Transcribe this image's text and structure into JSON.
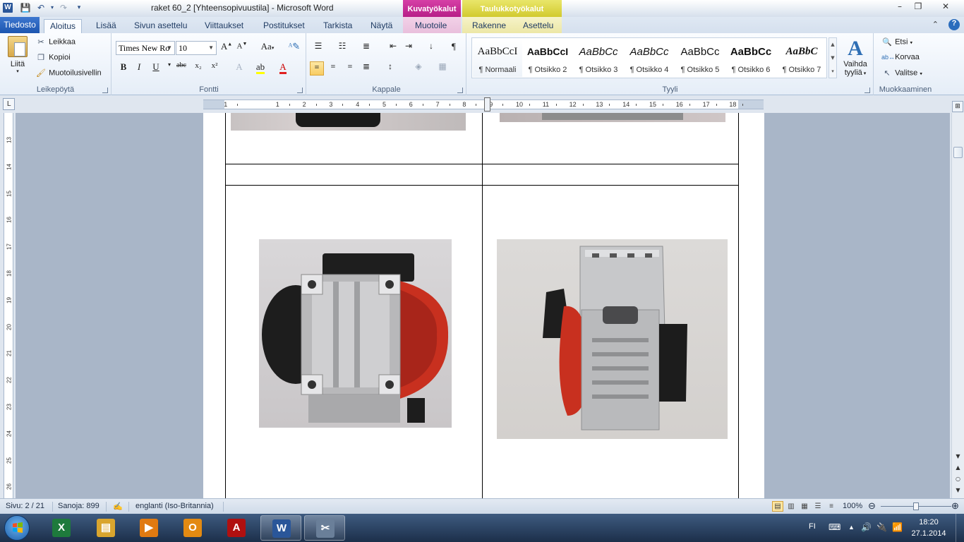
{
  "titlebar": {
    "app_letter": "W",
    "title": "raket 60_2 [Yhteensopivuustila]  -  Microsoft Word",
    "context_kuva": "Kuvatyökalut",
    "context_taulu": "Taulukkotyökalut",
    "min": "–",
    "max": "❐",
    "close": "✕"
  },
  "tabs": {
    "file": "Tiedosto",
    "items": [
      "Aloitus",
      "Lisää",
      "Sivun asettelu",
      "Viittaukset",
      "Postitukset",
      "Tarkista",
      "Näytä",
      "Muotoile",
      "Rakenne",
      "Asettelu"
    ]
  },
  "clipboard": {
    "paste": "Liitä",
    "cut": "Leikkaa",
    "copy": "Kopioi",
    "format_painter": "Muotoilusivellin",
    "label": "Leikepöytä"
  },
  "font": {
    "name": "Times New Ro",
    "size": "10",
    "label": "Fontti",
    "case_label": "Aa",
    "bold": "B",
    "italic": "I",
    "underline": "U",
    "strike": "abc",
    "sub": "x₂",
    "sup": "x²"
  },
  "paragraph": {
    "label": "Kappale",
    "pilcrow": "¶"
  },
  "styles": {
    "label": "Tyyli",
    "items": [
      {
        "sample": "AaBbCcI",
        "name": "¶ Normaali"
      },
      {
        "sample": "AaBbCcI",
        "name": "¶ Otsikko 2"
      },
      {
        "sample": "AaBbCc",
        "name": "¶ Otsikko 3"
      },
      {
        "sample": "AaBbCc",
        "name": "¶ Otsikko 4"
      },
      {
        "sample": "AaBbCc",
        "name": "¶ Otsikko 5"
      },
      {
        "sample": "AaBbCc",
        "name": "¶ Otsikko 6"
      },
      {
        "sample": "AaBbC",
        "name": "¶ Otsikko 7"
      }
    ],
    "change_line1": "Vaihda",
    "change_line2": "tyyliä"
  },
  "editing": {
    "label": "Muokkaaminen",
    "find": "Etsi",
    "replace": "Korvaa",
    "select": "Valitse"
  },
  "ruler": {
    "h_numbers": [
      "1",
      "1",
      "2",
      "3",
      "4",
      "5",
      "6",
      "7",
      "8",
      "9",
      "10",
      "11",
      "12",
      "13",
      "14",
      "15",
      "16",
      "17",
      "18"
    ],
    "v_numbers": [
      "13",
      "14",
      "15",
      "16",
      "17",
      "18",
      "19",
      "20",
      "21",
      "22",
      "23",
      "24",
      "25",
      "26"
    ]
  },
  "status": {
    "page": "Sivu: 2 / 21",
    "words": "Sanoja: 899",
    "language": "englanti (Iso-Britannia)",
    "zoom": "100%",
    "zoom_level": 1.0
  },
  "taskbar": {
    "apps": [
      {
        "name": "excel",
        "letter": "X",
        "color": "#1e7a3c"
      },
      {
        "name": "explorer",
        "letter": "▤",
        "color": "#d9a52e"
      },
      {
        "name": "media",
        "letter": "▶",
        "color": "#e07a12"
      },
      {
        "name": "outlook",
        "letter": "O",
        "color": "#e38a12"
      },
      {
        "name": "acrobat",
        "letter": "A",
        "color": "#b01010"
      },
      {
        "name": "word",
        "letter": "W",
        "color": "#2a5699"
      },
      {
        "name": "snipping",
        "letter": "✂",
        "color": "#6a7f99"
      }
    ],
    "lang": "FI",
    "time": "18:20",
    "date": "27.1.2014"
  }
}
